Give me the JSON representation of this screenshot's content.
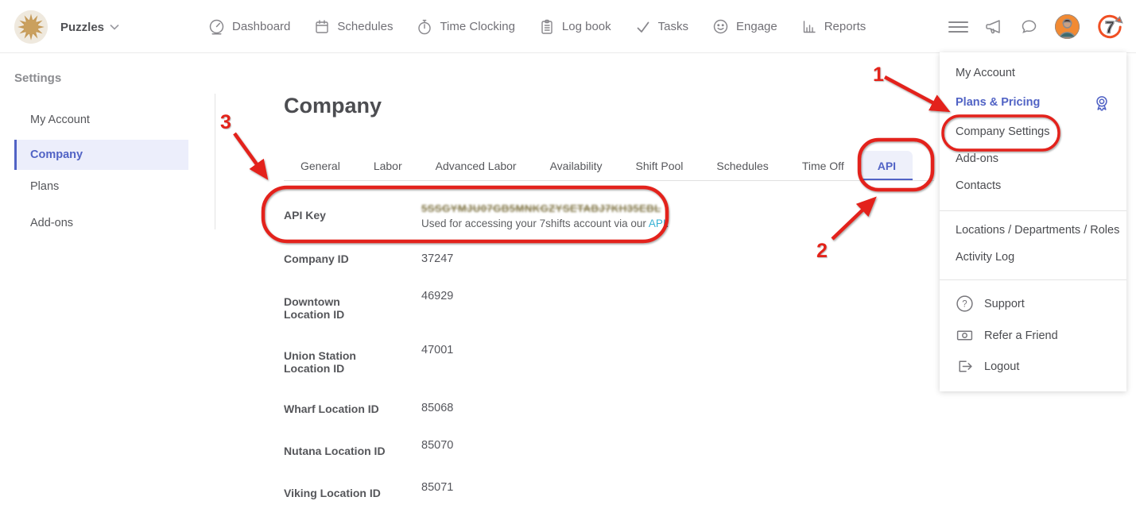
{
  "brand": {
    "company_name": "Puzzles",
    "logo_glyph_7": "7"
  },
  "nav": {
    "items": [
      {
        "label": "Dashboard",
        "icon": "dashboard-gauge-icon"
      },
      {
        "label": "Schedules",
        "icon": "calendar-icon"
      },
      {
        "label": "Time Clocking",
        "icon": "stopwatch-icon"
      },
      {
        "label": "Log book",
        "icon": "clipboard-icon"
      },
      {
        "label": "Tasks",
        "icon": "checkmark-icon"
      },
      {
        "label": "Engage",
        "icon": "smiley-icon"
      },
      {
        "label": "Reports",
        "icon": "bar-chart-icon"
      }
    ]
  },
  "sidebar": {
    "title": "Settings",
    "items": [
      {
        "label": "My Account",
        "selected": false
      },
      {
        "label": "Company",
        "selected": true
      },
      {
        "label": "Plans",
        "selected": false
      },
      {
        "label": "Add-ons",
        "selected": false
      }
    ]
  },
  "main": {
    "title": "Company",
    "tabs": [
      "General",
      "Labor",
      "Advanced Labor",
      "Availability",
      "Shift Pool",
      "Schedules",
      "Time Off",
      "API"
    ],
    "active_tab": "API",
    "fields": [
      {
        "label": "API Key",
        "value": "5SSGYMJU07GB5MNKGZYSETABJ7KH35EBL",
        "obscured": true,
        "description_prefix": "Used for accessing your 7shifts account via our ",
        "link_text": "API",
        "description_suffix": "."
      },
      {
        "label": "Company ID",
        "value": "37247"
      },
      {
        "label": "Downtown Location ID",
        "value": "46929"
      },
      {
        "label": "Union Station Location ID",
        "value": "47001"
      },
      {
        "label": "Wharf Location ID",
        "value": "85068"
      },
      {
        "label": "Nutana Location ID",
        "value": "85070"
      },
      {
        "label": "Viking Location ID",
        "value": "85071"
      }
    ]
  },
  "account_menu": {
    "items": [
      {
        "label": "My Account"
      },
      {
        "label": "Plans & Pricing",
        "highlight": true,
        "icon": "award-badge-icon"
      },
      {
        "label": "Company Settings"
      },
      {
        "label": "Add-ons"
      },
      {
        "label": "Contacts"
      },
      {
        "label": "Locations / Departments / Roles"
      },
      {
        "label": "Activity Log"
      },
      {
        "label": "Support",
        "icon": "help-icon"
      },
      {
        "label": "Refer a Friend",
        "icon": "money-bill-icon"
      },
      {
        "label": "Logout",
        "icon": "logout-icon"
      }
    ]
  },
  "annotations": {
    "color": "#e3231a",
    "steps": [
      "1",
      "2",
      "3"
    ]
  },
  "icons": {
    "help_glyph": "?"
  },
  "colors": {
    "accent_purple": "#5163c5",
    "selected_bg": "#eceefb",
    "link_teal": "#35b1d4",
    "annotation_red": "#e3231a",
    "avatar_orange": "#f18a33",
    "logo7_orange": "#f04f23",
    "api_key_olive": "#877c4f"
  }
}
